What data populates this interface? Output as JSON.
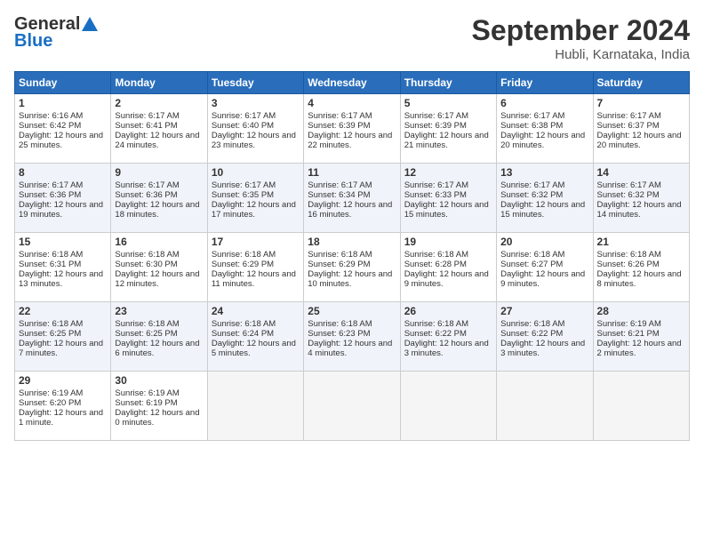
{
  "header": {
    "logo_line1": "General",
    "logo_line2": "Blue",
    "month": "September 2024",
    "location": "Hubli, Karnataka, India"
  },
  "days_of_week": [
    "Sunday",
    "Monday",
    "Tuesday",
    "Wednesday",
    "Thursday",
    "Friday",
    "Saturday"
  ],
  "weeks": [
    [
      {
        "day": 1,
        "sunrise": "6:16 AM",
        "sunset": "6:42 PM",
        "daylight": "12 hours and 25 minutes."
      },
      {
        "day": 2,
        "sunrise": "6:17 AM",
        "sunset": "6:41 PM",
        "daylight": "12 hours and 24 minutes."
      },
      {
        "day": 3,
        "sunrise": "6:17 AM",
        "sunset": "6:40 PM",
        "daylight": "12 hours and 23 minutes."
      },
      {
        "day": 4,
        "sunrise": "6:17 AM",
        "sunset": "6:39 PM",
        "daylight": "12 hours and 22 minutes."
      },
      {
        "day": 5,
        "sunrise": "6:17 AM",
        "sunset": "6:39 PM",
        "daylight": "12 hours and 21 minutes."
      },
      {
        "day": 6,
        "sunrise": "6:17 AM",
        "sunset": "6:38 PM",
        "daylight": "12 hours and 20 minutes."
      },
      {
        "day": 7,
        "sunrise": "6:17 AM",
        "sunset": "6:37 PM",
        "daylight": "12 hours and 20 minutes."
      }
    ],
    [
      {
        "day": 8,
        "sunrise": "6:17 AM",
        "sunset": "6:36 PM",
        "daylight": "12 hours and 19 minutes."
      },
      {
        "day": 9,
        "sunrise": "6:17 AM",
        "sunset": "6:36 PM",
        "daylight": "12 hours and 18 minutes."
      },
      {
        "day": 10,
        "sunrise": "6:17 AM",
        "sunset": "6:35 PM",
        "daylight": "12 hours and 17 minutes."
      },
      {
        "day": 11,
        "sunrise": "6:17 AM",
        "sunset": "6:34 PM",
        "daylight": "12 hours and 16 minutes."
      },
      {
        "day": 12,
        "sunrise": "6:17 AM",
        "sunset": "6:33 PM",
        "daylight": "12 hours and 15 minutes."
      },
      {
        "day": 13,
        "sunrise": "6:17 AM",
        "sunset": "6:32 PM",
        "daylight": "12 hours and 15 minutes."
      },
      {
        "day": 14,
        "sunrise": "6:17 AM",
        "sunset": "6:32 PM",
        "daylight": "12 hours and 14 minutes."
      }
    ],
    [
      {
        "day": 15,
        "sunrise": "6:18 AM",
        "sunset": "6:31 PM",
        "daylight": "12 hours and 13 minutes."
      },
      {
        "day": 16,
        "sunrise": "6:18 AM",
        "sunset": "6:30 PM",
        "daylight": "12 hours and 12 minutes."
      },
      {
        "day": 17,
        "sunrise": "6:18 AM",
        "sunset": "6:29 PM",
        "daylight": "12 hours and 11 minutes."
      },
      {
        "day": 18,
        "sunrise": "6:18 AM",
        "sunset": "6:29 PM",
        "daylight": "12 hours and 10 minutes."
      },
      {
        "day": 19,
        "sunrise": "6:18 AM",
        "sunset": "6:28 PM",
        "daylight": "12 hours and 9 minutes."
      },
      {
        "day": 20,
        "sunrise": "6:18 AM",
        "sunset": "6:27 PM",
        "daylight": "12 hours and 9 minutes."
      },
      {
        "day": 21,
        "sunrise": "6:18 AM",
        "sunset": "6:26 PM",
        "daylight": "12 hours and 8 minutes."
      }
    ],
    [
      {
        "day": 22,
        "sunrise": "6:18 AM",
        "sunset": "6:25 PM",
        "daylight": "12 hours and 7 minutes."
      },
      {
        "day": 23,
        "sunrise": "6:18 AM",
        "sunset": "6:25 PM",
        "daylight": "12 hours and 6 minutes."
      },
      {
        "day": 24,
        "sunrise": "6:18 AM",
        "sunset": "6:24 PM",
        "daylight": "12 hours and 5 minutes."
      },
      {
        "day": 25,
        "sunrise": "6:18 AM",
        "sunset": "6:23 PM",
        "daylight": "12 hours and 4 minutes."
      },
      {
        "day": 26,
        "sunrise": "6:18 AM",
        "sunset": "6:22 PM",
        "daylight": "12 hours and 3 minutes."
      },
      {
        "day": 27,
        "sunrise": "6:18 AM",
        "sunset": "6:22 PM",
        "daylight": "12 hours and 3 minutes."
      },
      {
        "day": 28,
        "sunrise": "6:19 AM",
        "sunset": "6:21 PM",
        "daylight": "12 hours and 2 minutes."
      }
    ],
    [
      {
        "day": 29,
        "sunrise": "6:19 AM",
        "sunset": "6:20 PM",
        "daylight": "12 hours and 1 minute."
      },
      {
        "day": 30,
        "sunrise": "6:19 AM",
        "sunset": "6:19 PM",
        "daylight": "12 hours and 0 minutes."
      },
      null,
      null,
      null,
      null,
      null
    ]
  ]
}
